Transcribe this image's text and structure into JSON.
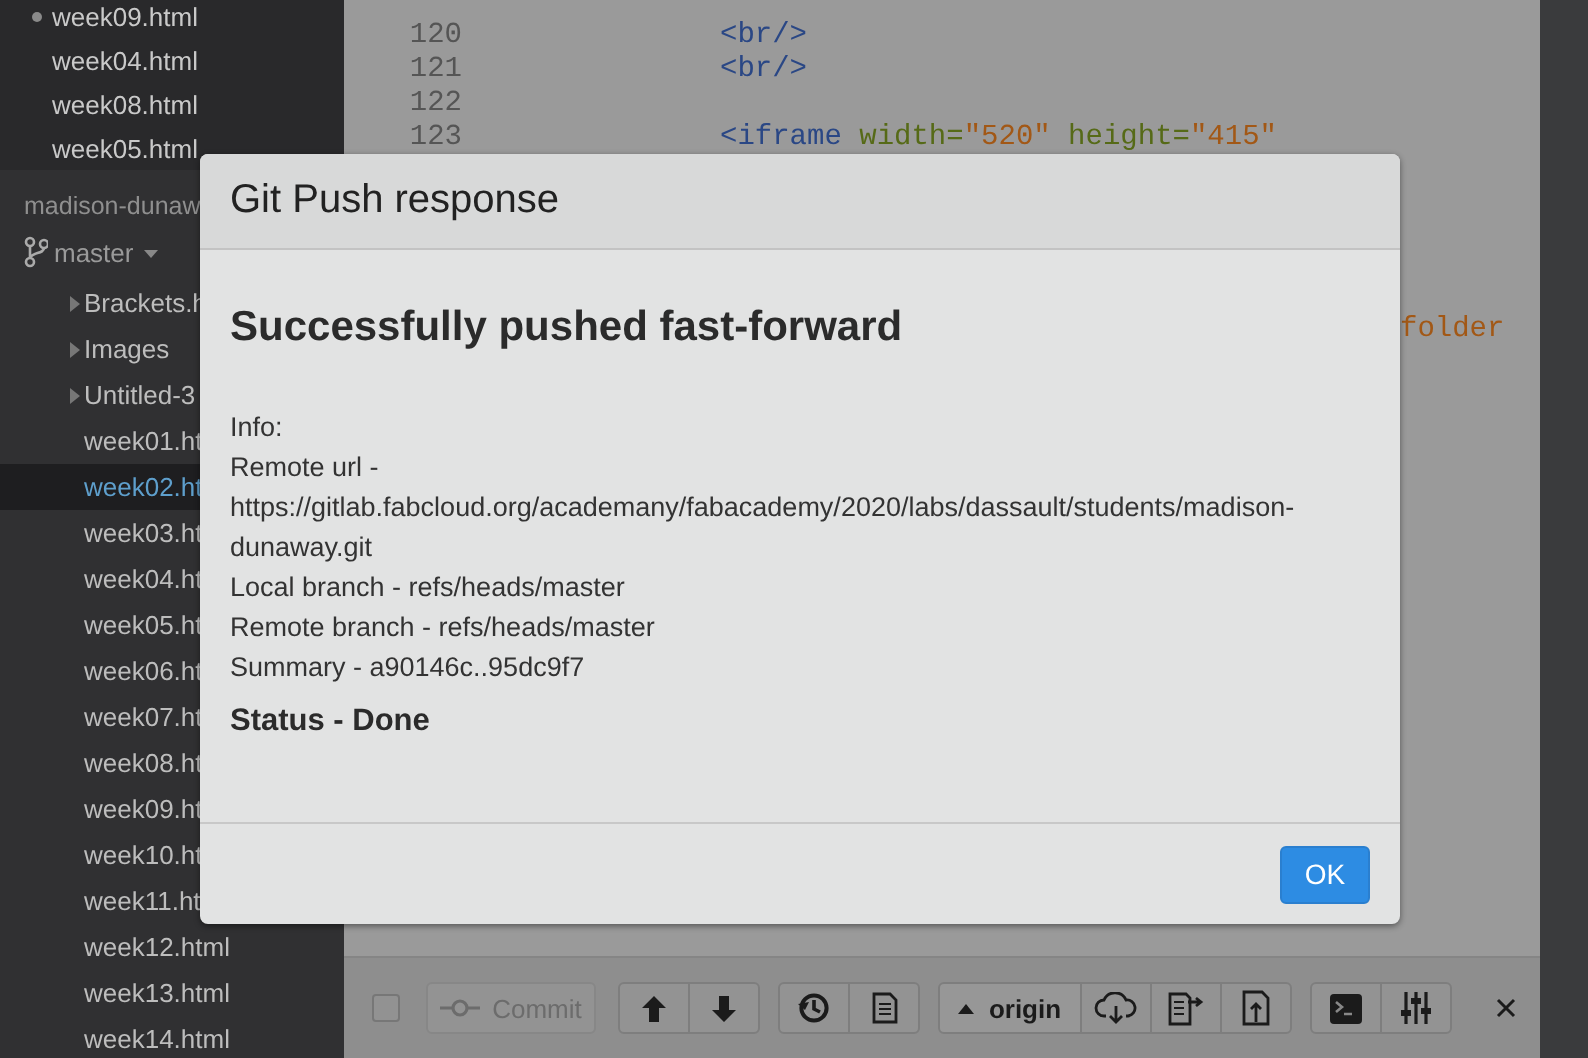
{
  "sidebar": {
    "working_files": [
      {
        "name": "week09.html",
        "dirty": true
      },
      {
        "name": "week04.html",
        "dirty": false
      },
      {
        "name": "week08.html",
        "dirty": false
      },
      {
        "name": "week05.html",
        "dirty": false
      }
    ],
    "project": {
      "name": "madison-dunaw",
      "branch": "master"
    },
    "tree": [
      {
        "name": "Brackets.h",
        "kind": "folder",
        "selected": false
      },
      {
        "name": "Images",
        "kind": "folder",
        "selected": false
      },
      {
        "name": "Untitled-3",
        "kind": "folder",
        "selected": false
      },
      {
        "name": "week01.ht",
        "kind": "file",
        "selected": false
      },
      {
        "name": "week02.ht",
        "kind": "file",
        "selected": true
      },
      {
        "name": "week03.ht",
        "kind": "file",
        "selected": false
      },
      {
        "name": "week04.ht",
        "kind": "file",
        "selected": false
      },
      {
        "name": "week05.ht",
        "kind": "file",
        "selected": false
      },
      {
        "name": "week06.ht",
        "kind": "file",
        "selected": false
      },
      {
        "name": "week07.ht",
        "kind": "file",
        "selected": false
      },
      {
        "name": "week08.ht",
        "kind": "file",
        "selected": false
      },
      {
        "name": "week09.ht",
        "kind": "file",
        "selected": false
      },
      {
        "name": "week10.ht",
        "kind": "file",
        "selected": false
      },
      {
        "name": "week11.ht",
        "kind": "file",
        "selected": false
      },
      {
        "name": "week12.html",
        "kind": "file",
        "selected": false
      },
      {
        "name": "week13.html",
        "kind": "file",
        "selected": false
      },
      {
        "name": "week14.html",
        "kind": "file",
        "selected": false
      }
    ]
  },
  "editor": {
    "lines": [
      {
        "number": "120",
        "tokens": [
          {
            "kind": "tag",
            "text": "<br/>"
          }
        ]
      },
      {
        "number": "121",
        "tokens": [
          {
            "kind": "tag",
            "text": "<br/>"
          }
        ]
      },
      {
        "number": "122"
      },
      {
        "number": "123",
        "tokens": [
          {
            "kind": "tag",
            "text": "<iframe"
          },
          {
            "kind": "attr",
            "text": " width="
          },
          {
            "kind": "string",
            "text": "\"520\""
          },
          {
            "kind": "attr",
            "text": " height="
          },
          {
            "kind": "string",
            "text": "\"415\""
          }
        ]
      }
    ],
    "cut_text": "folder"
  },
  "toolbar": {
    "commit": {
      "label": "Commit",
      "disabled": true,
      "checked": false
    },
    "remote": {
      "label": "origin"
    }
  },
  "dialog": {
    "title": "Git Push response",
    "heading": "Successfully pushed fast-forward",
    "info": [
      "Info:",
      "Remote url -",
      "https://gitlab.fabcloud.org/academany/fabacademy/2020/labs/dassault/students/madison-dunaway.git",
      "Local branch - refs/heads/master",
      "Remote branch - refs/heads/master",
      "Summary - a90146c..95dc9f7"
    ],
    "status": "Status - Done",
    "ok_button": "OK"
  }
}
